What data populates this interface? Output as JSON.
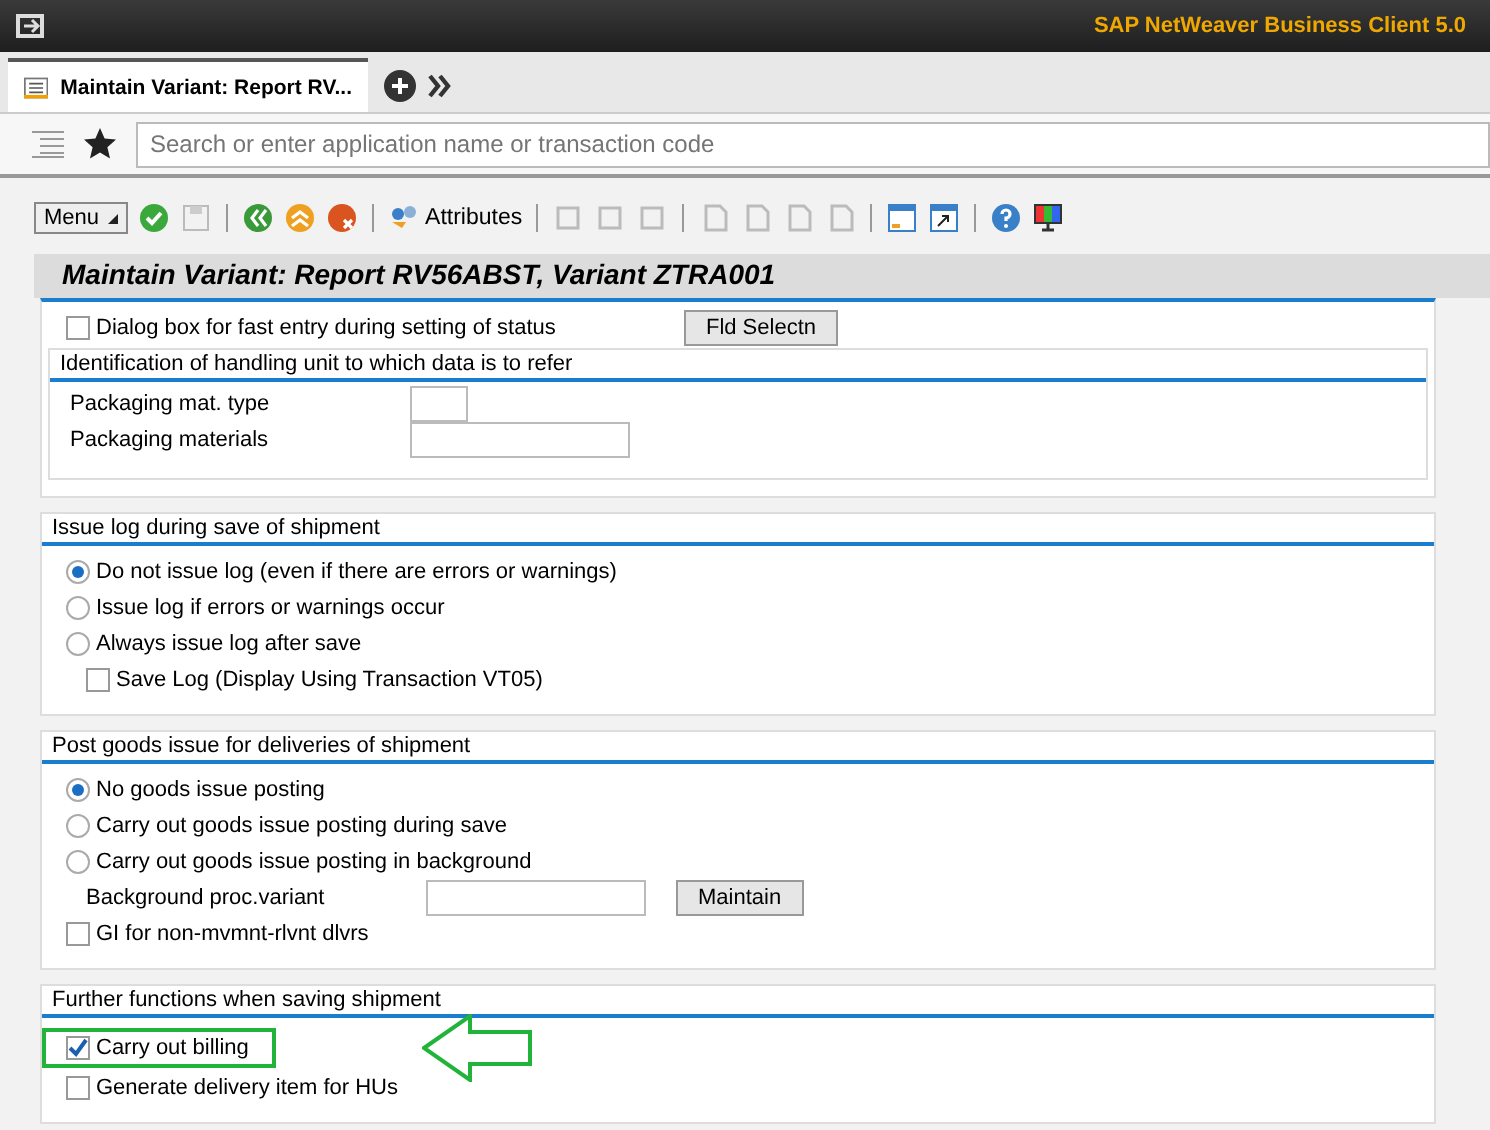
{
  "window": {
    "title": "SAP NetWeaver Business Client 5.0"
  },
  "tabs": [
    {
      "label": "Maintain Variant: Report RV...",
      "selected": true
    }
  ],
  "search": {
    "placeholder": "Search or enter application name or transaction code"
  },
  "toolbar": {
    "menu": "Menu",
    "attributes": "Attributes"
  },
  "page_title": "Maintain Variant: Report RV56ABST, Variant ZTRA001",
  "sections": [
    {
      "rows": [
        {
          "kind": "checkbox",
          "label": "Dialog box for fast entry during setting of status",
          "checked": false,
          "button": "Fld Selectn"
        }
      ],
      "subgroup": {
        "title": "Identification of handling unit to which data is to refer",
        "rows": [
          {
            "kind": "short-field",
            "label": "Packaging mat. type"
          },
          {
            "kind": "field",
            "label": "Packaging materials"
          }
        ]
      }
    },
    {
      "title": "Issue log during save of shipment",
      "rows": [
        {
          "kind": "radio",
          "label": "Do not issue log (even if there are errors or warnings)",
          "selected": true
        },
        {
          "kind": "radio",
          "label": "Issue log if errors or warnings occur",
          "selected": false
        },
        {
          "kind": "radio",
          "label": "Always issue log after save",
          "selected": false
        },
        {
          "kind": "nested-checkbox",
          "label": "Save Log (Display Using Transaction VT05)",
          "checked": false
        }
      ]
    },
    {
      "title": "Post goods issue for deliveries of shipment",
      "rows": [
        {
          "kind": "radio",
          "label": "No goods issue posting",
          "selected": true
        },
        {
          "kind": "radio",
          "label": "Carry out goods issue posting during save",
          "selected": false
        },
        {
          "kind": "radio",
          "label": "Carry out goods issue posting in background",
          "selected": false
        },
        {
          "kind": "field",
          "label": "Background proc.variant",
          "button": "Maintain"
        },
        {
          "kind": "checkbox",
          "label": "GI for non-mvmnt-rlvnt dlvrs",
          "checked": false
        }
      ]
    },
    {
      "title": "Further functions when saving shipment",
      "rows": [
        {
          "kind": "checkbox",
          "label": "Carry out billing",
          "checked": true,
          "highlighted": true
        },
        {
          "kind": "checkbox",
          "label": "Generate delivery item for HUs",
          "checked": false
        }
      ]
    }
  ]
}
